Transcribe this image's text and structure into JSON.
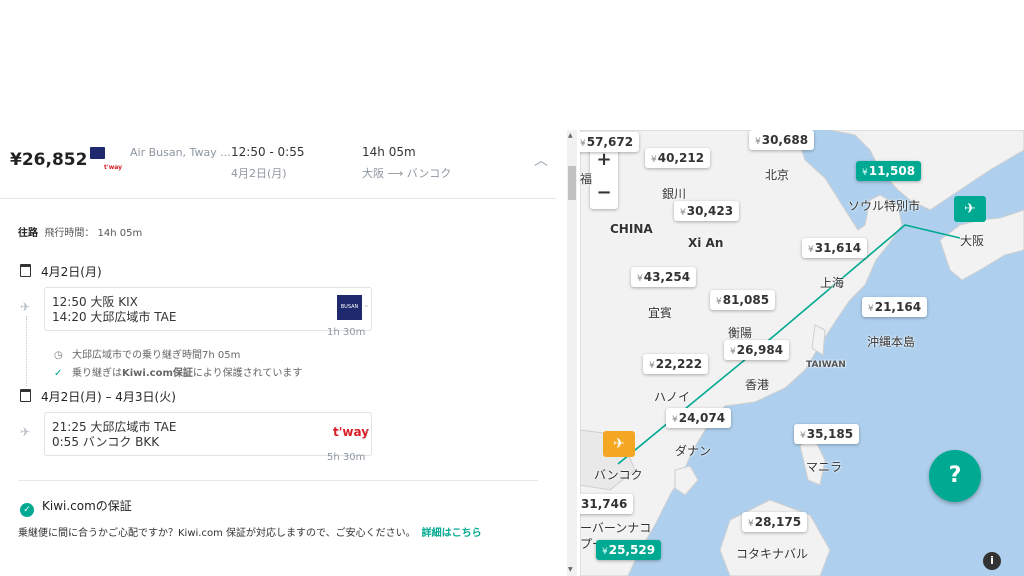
{
  "summary": {
    "price": "¥26,852",
    "carriers": "Air Busan, Tway ...",
    "tway_logo_small": "t'way",
    "times": "12:50 - 0:55",
    "date": "4月2日(月)",
    "duration": "14h 05m",
    "route": "大阪 ⟶ バンコク"
  },
  "detail": {
    "outbound_label": "往路",
    "flight_time": "飛行時間： 14h 05m",
    "date1": "4月2日(月)",
    "seg1": {
      "line1": "12:50  大阪 KIX",
      "line2": "14:20  大邱広域市 TAE",
      "logo": "BUSAN",
      "duration": "1h 30m"
    },
    "layover": "大邱広域市での乗り継ぎ時間7h 05m",
    "protected_pre": "乗り継ぎは",
    "protected_bold": "Kiwi.com保証",
    "protected_post": "により保護されています",
    "date2": "4月2日(月) – 4月3日(火)",
    "seg2": {
      "line1": "21:25  大邱広域市 TAE",
      "line2": "0:55    バンコク BKK",
      "logo": "t'way",
      "duration": "5h 30m"
    }
  },
  "guarantee": {
    "title": "Kiwi.comの保証",
    "text": "乗継便に間に合うかご心配ですか？Kiwi.com 保証が対応しますので、ご安心ください。",
    "link": "詳細はこちら"
  },
  "map": {
    "pins": [
      {
        "currency": "¥",
        "price": "57,672"
      },
      {
        "currency": "¥",
        "price": "30,688"
      },
      {
        "currency": "¥",
        "price": "40,212"
      },
      {
        "currency": "¥",
        "price": "11,508"
      },
      {
        "currency": "¥",
        "price": "30,423"
      },
      {
        "currency": "¥",
        "price": "31,614"
      },
      {
        "currency": "¥",
        "price": "43,254"
      },
      {
        "currency": "¥",
        "price": "81,085"
      },
      {
        "currency": "¥",
        "price": "21,164"
      },
      {
        "currency": "¥",
        "price": "26,984"
      },
      {
        "currency": "¥",
        "price": "22,222"
      },
      {
        "currency": "¥",
        "price": "24,074"
      },
      {
        "currency": "¥",
        "price": "35,185"
      },
      {
        "currency": "",
        "price": "31,746"
      },
      {
        "currency": "¥",
        "price": "28,175"
      },
      {
        "currency": "¥",
        "price": "25,529"
      }
    ],
    "labels": [
      "北京",
      "銀川",
      "CHINA",
      "Xi An",
      "ソウル特別市",
      "大阪",
      "上海",
      "宜賓",
      "衡陽",
      "沖縄本島",
      "TAIWAN",
      "香港",
      "ハノイ",
      "ダナン",
      "マニラ",
      "バンコク",
      "ーバーンナコ",
      "プー",
      "コタキナバル",
      "福"
    ],
    "zoom_in": "+",
    "zoom_out": "−",
    "help": "?",
    "info": "i",
    "colors": {
      "accent": "#00a991",
      "origin": "#f3a723",
      "sea": "#aed0ee",
      "land": "#f2f2f2"
    }
  }
}
